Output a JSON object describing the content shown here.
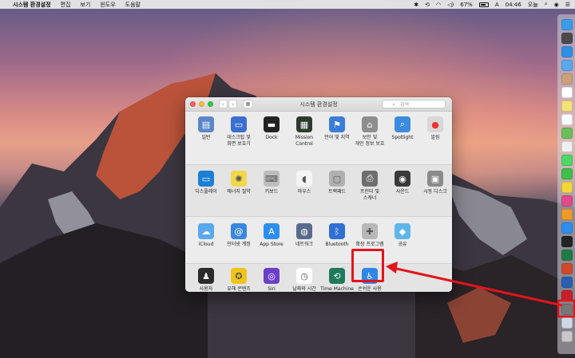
{
  "menubar": {
    "app_name": "시스템 환경설정",
    "menus": [
      "편집",
      "보기",
      "윈도우",
      "도움말"
    ],
    "battery_percent": "67%",
    "time": "04:46",
    "day": "오늘"
  },
  "window": {
    "title": "시스템 환경설정",
    "search_placeholder": "검색"
  },
  "sections": [
    [
      {
        "name": "general",
        "label": "일반",
        "icon": "general-icon",
        "color": "#5b86c9"
      },
      {
        "name": "desktop-screensaver",
        "label": "데스크탑 및\n화면 보호기",
        "icon": "desktop-icon",
        "color": "#3a6fd0"
      },
      {
        "name": "dock",
        "label": "Dock",
        "icon": "dock-icon",
        "color": "#222"
      },
      {
        "name": "mission-control",
        "label": "Mission\nControl",
        "icon": "mission-control-icon",
        "color": "#2f3a2f"
      },
      {
        "name": "language-region",
        "label": "언어 및 지역",
        "icon": "globe-flag-icon",
        "color": "#3b7dd8"
      },
      {
        "name": "security-privacy",
        "label": "보안 및\n개인 정보 보호",
        "icon": "house-lock-icon",
        "color": "#8e8e8e"
      },
      {
        "name": "spotlight",
        "label": "Spotlight",
        "icon": "spotlight-icon",
        "color": "#3b8ce0"
      },
      {
        "name": "notifications",
        "label": "알림",
        "icon": "notifications-icon",
        "color": "#d8d8d8"
      }
    ],
    [
      {
        "name": "displays",
        "label": "디스플레이",
        "icon": "display-icon",
        "color": "#1c7fd6"
      },
      {
        "name": "energy-saver",
        "label": "에너지 절약",
        "icon": "lightbulb-icon",
        "color": "#f2d64b"
      },
      {
        "name": "keyboard",
        "label": "키보드",
        "icon": "keyboard-icon",
        "color": "#bdbdbd"
      },
      {
        "name": "mouse",
        "label": "마우스",
        "icon": "mouse-icon",
        "color": "#f4f4f4"
      },
      {
        "name": "trackpad",
        "label": "트랙패드",
        "icon": "trackpad-icon",
        "color": "#b0b0b0"
      },
      {
        "name": "printers-scanners",
        "label": "프린터 및\n스캐너",
        "icon": "printer-icon",
        "color": "#6e6e6e"
      },
      {
        "name": "sound",
        "label": "사운드",
        "icon": "speaker-icon",
        "color": "#3a3a3a"
      },
      {
        "name": "startup-disk",
        "label": "시동 디스크",
        "icon": "disk-icon",
        "color": "#8a8a8a"
      }
    ],
    [
      {
        "name": "icloud",
        "label": "iCloud",
        "icon": "cloud-icon",
        "color": "#5aa8ee"
      },
      {
        "name": "internet-accounts",
        "label": "인터넷 계정",
        "icon": "at-icon",
        "color": "#3a86e0"
      },
      {
        "name": "app-store",
        "label": "App Store",
        "icon": "app-store-icon",
        "color": "#2d8ef0"
      },
      {
        "name": "network",
        "label": "네트워크",
        "icon": "network-globe-icon",
        "color": "#5a6a8a"
      },
      {
        "name": "bluetooth",
        "label": "Bluetooth",
        "icon": "bluetooth-icon",
        "color": "#2f6fd6"
      },
      {
        "name": "extensions",
        "label": "확장 프로그램",
        "icon": "puzzle-icon",
        "color": "#b8b8b8"
      },
      {
        "name": "sharing",
        "label": "공유",
        "icon": "sharing-folder-icon",
        "color": "#5eb7e8"
      }
    ],
    [
      {
        "name": "users-groups",
        "label": "사용자\n및 그룹",
        "icon": "users-icon",
        "color": "#2b2b2b"
      },
      {
        "name": "parental-controls",
        "label": "유해 콘텐츠\n차단",
        "icon": "parental-controls-icon",
        "color": "#f0c419"
      },
      {
        "name": "siri",
        "label": "Siri",
        "icon": "siri-icon",
        "color": "#6b3fc9"
      },
      {
        "name": "date-time",
        "label": "날짜와 시간",
        "icon": "clock-calendar-icon",
        "color": "#ffffff"
      },
      {
        "name": "time-machine",
        "label": "Time Machine",
        "icon": "time-machine-icon",
        "color": "#1f7a5a"
      },
      {
        "name": "accessibility",
        "label": "손쉬운 사용",
        "icon": "accessibility-icon",
        "color": "#2f86e6"
      }
    ]
  ],
  "dock_items": [
    {
      "name": "finder",
      "icon": "finder-icon",
      "color": "#3a9be8"
    },
    {
      "name": "launchpad",
      "icon": "launchpad-icon",
      "color": "#4a4a4a"
    },
    {
      "name": "safari",
      "icon": "safari-icon",
      "color": "#2f8fe6"
    },
    {
      "name": "mail",
      "icon": "mail-icon",
      "color": "#5aa8ee"
    },
    {
      "name": "contacts",
      "icon": "contacts-icon",
      "color": "#c9a27a"
    },
    {
      "name": "calendar",
      "icon": "calendar-icon",
      "color": "#ffffff"
    },
    {
      "name": "notes",
      "icon": "notes-icon",
      "color": "#f5e27a"
    },
    {
      "name": "reminders",
      "icon": "reminders-icon",
      "color": "#ffffff"
    },
    {
      "name": "maps",
      "icon": "maps-icon",
      "color": "#6bbf5a"
    },
    {
      "name": "photos",
      "icon": "photos-icon",
      "color": "#f0f0f0"
    },
    {
      "name": "messages",
      "icon": "messages-icon",
      "color": "#4cd964"
    },
    {
      "name": "facetime",
      "icon": "facetime-icon",
      "color": "#3fbf4a"
    },
    {
      "name": "kakaotalk",
      "icon": "chat-bubble-icon",
      "color": "#f5d63a"
    },
    {
      "name": "itunes",
      "icon": "itunes-icon",
      "color": "#e04a8a"
    },
    {
      "name": "ibooks",
      "icon": "book-icon",
      "color": "#f09a2a"
    },
    {
      "name": "app-store-dock",
      "icon": "app-store-icon",
      "color": "#2d8ef0"
    },
    {
      "name": "terminal",
      "icon": "terminal-icon",
      "color": "#222222"
    },
    {
      "name": "excel",
      "icon": "excel-icon",
      "color": "#1f7a44"
    },
    {
      "name": "powerpoint",
      "icon": "powerpoint-icon",
      "color": "#d04a2a"
    },
    {
      "name": "word",
      "icon": "word-icon",
      "color": "#2b5fb4"
    },
    {
      "name": "photo-booth",
      "icon": "photo-booth-icon",
      "color": "#c8202a"
    },
    {
      "name": "system-preferences-dock",
      "icon": "gear-icon",
      "color": "#777777"
    },
    {
      "name": "downloads",
      "icon": "downloads-stack-icon",
      "color": "#cfd8e6"
    },
    {
      "name": "trash",
      "icon": "trash-icon",
      "color": "#c8c8c8"
    }
  ],
  "highlight_color": "#e3141c"
}
